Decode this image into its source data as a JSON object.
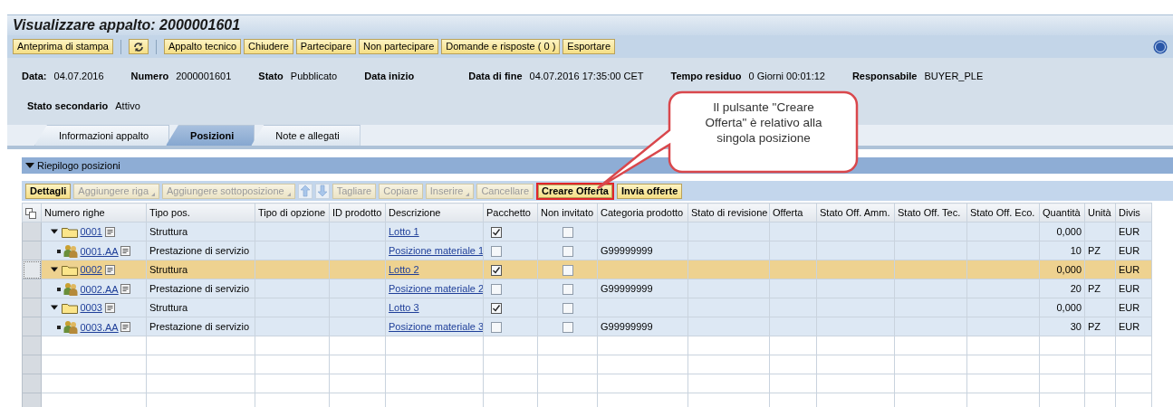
{
  "window": {
    "title": "Visualizzare appalto: 2000001601"
  },
  "toolbar": [
    {
      "kind": "button",
      "label": "Anteprima di stampa"
    },
    {
      "kind": "separator"
    },
    {
      "kind": "refresh"
    },
    {
      "kind": "separator"
    },
    {
      "kind": "button",
      "label": "Appalto tecnico"
    },
    {
      "kind": "button",
      "label": "Chiudere"
    },
    {
      "kind": "button",
      "label": "Partecipare"
    },
    {
      "kind": "button",
      "label": "Non partecipare"
    },
    {
      "kind": "button",
      "label": "Domande e risposte ( 0 )"
    },
    {
      "kind": "button",
      "label": "Esportare"
    }
  ],
  "header_fields": [
    [
      {
        "label": "Data:",
        "value": "04.07.2016"
      },
      {
        "label": "Numero",
        "value": "2000001601"
      },
      {
        "label": "Stato",
        "value": "Pubblicato"
      },
      {
        "label": "Data inizio"
      },
      {
        "label": "Data di fine",
        "value": "04.07.2016 17:35:00 CET"
      },
      {
        "label": "Tempo residuo",
        "value": "0 Giorni 00:01:12"
      },
      {
        "label": "Responsabile",
        "value": "BUYER_PLE"
      }
    ],
    [
      {
        "label": "Stato secondario",
        "value": "Attivo"
      }
    ]
  ],
  "tabs": [
    {
      "label": "Informazioni appalto",
      "selected": false
    },
    {
      "label": "Posizioni",
      "selected": true
    },
    {
      "label": "Note e allegati",
      "selected": false
    }
  ],
  "section": {
    "title": "Riepilogo posizioni",
    "expanded": true
  },
  "table_toolbar": [
    {
      "kind": "button",
      "label": "Dettagli",
      "disabled": false,
      "menu": false,
      "highlighted": false
    },
    {
      "kind": "button",
      "label": "Aggiungere riga",
      "disabled": true,
      "menu": true,
      "highlighted": false
    },
    {
      "kind": "button",
      "label": "Aggiungere sottoposizione",
      "disabled": true,
      "menu": true,
      "highlighted": false
    },
    {
      "kind": "up",
      "disabled": true
    },
    {
      "kind": "down",
      "disabled": true
    },
    {
      "kind": "button",
      "label": "Tagliare",
      "disabled": true,
      "menu": false,
      "highlighted": false
    },
    {
      "kind": "button",
      "label": "Copiare",
      "disabled": true,
      "menu": false,
      "highlighted": false
    },
    {
      "kind": "button",
      "label": "Inserire",
      "disabled": true,
      "menu": true,
      "highlighted": false
    },
    {
      "kind": "button",
      "label": "Cancellare",
      "disabled": true,
      "menu": false,
      "highlighted": false
    },
    {
      "kind": "button",
      "label": "Creare Offerta",
      "disabled": false,
      "menu": false,
      "highlighted": true
    },
    {
      "kind": "button",
      "label": "Invia offerte",
      "disabled": false,
      "menu": false,
      "highlighted": false
    }
  ],
  "table": {
    "columns": [
      "Numero righe",
      "Tipo pos.",
      "Tipo di opzione",
      "ID prodotto",
      "Descrizione",
      "Pacchetto",
      "Non invitato",
      "Categoria prodotto",
      "Stato di revisione",
      "Offerta",
      "Stato Off. Amm.",
      "Stato Off. Tec.",
      "Stato Off. Eco.",
      "Quantità",
      "Unità",
      "Divis"
    ],
    "rows": [
      {
        "kind": "structure",
        "number": "0001",
        "type": "Struttura",
        "description": "Lotto 1",
        "package": true,
        "not_invited": false,
        "quantity": "0,000",
        "currency": "EUR",
        "selected": false,
        "expanded": true,
        "children": [
          {
            "kind": "service",
            "number": "0001.AA",
            "type": "Prestazione di servizio",
            "description": "Posizione materiale 1",
            "package": false,
            "not_invited": false,
            "category": "G99999999",
            "quantity": "10",
            "unit": "PZ",
            "currency": "EUR",
            "selected": false
          }
        ]
      },
      {
        "kind": "structure",
        "number": "0002",
        "type": "Struttura",
        "description": "Lotto 2",
        "package": true,
        "not_invited": false,
        "quantity": "0,000",
        "currency": "EUR",
        "selected": true,
        "expanded": true,
        "children": [
          {
            "kind": "service",
            "number": "0002.AA",
            "type": "Prestazione di servizio",
            "description": "Posizione materiale 2",
            "package": false,
            "not_invited": false,
            "category": "G99999999",
            "quantity": "20",
            "unit": "PZ",
            "currency": "EUR",
            "selected": false
          }
        ]
      },
      {
        "kind": "structure",
        "number": "0003",
        "type": "Struttura",
        "description": "Lotto 3",
        "package": true,
        "not_invited": false,
        "quantity": "0,000",
        "currency": "EUR",
        "selected": false,
        "expanded": true,
        "children": [
          {
            "kind": "service",
            "number": "0003.AA",
            "type": "Prestazione di servizio",
            "description": "Posizione materiale 3",
            "package": false,
            "not_invited": false,
            "category": "G99999999",
            "quantity": "30",
            "unit": "PZ",
            "currency": "EUR",
            "selected": false
          }
        ]
      }
    ]
  },
  "callout": {
    "text": "Il pulsante \"Creare Offerta\" è relativo alla singola posizione"
  }
}
